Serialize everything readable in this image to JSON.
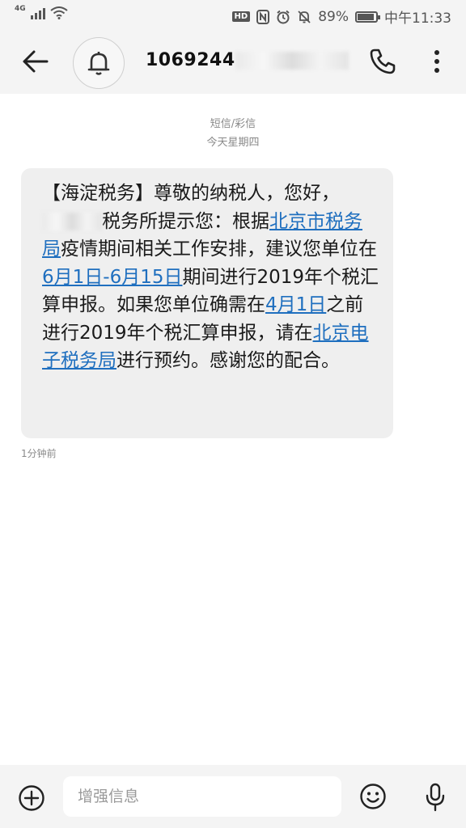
{
  "status_bar": {
    "network": "4G",
    "battery": "89%",
    "battery_level": 0.89,
    "time": "中午11:33",
    "icons": [
      "signal-icon",
      "wifi-icon",
      "hd-icon",
      "nfc-icon",
      "alarm-icon",
      "mute-icon",
      "battery-icon"
    ]
  },
  "header": {
    "contact": "1069244",
    "icons": [
      "back-arrow-icon",
      "bell-icon",
      "phone-icon",
      "more-vertical-icon"
    ]
  },
  "thread": {
    "message_type": "短信/彩信",
    "date_label": "今天星期四",
    "message": {
      "part1": "【海淀税务】尊敬的纳税人，您好，",
      "part2": "税务所提示您：根据",
      "link1": "北京市税务局",
      "part3": "疫情期间相关工作安排，建议您单位在",
      "link2": "6月1日-6月15日",
      "part4": "期间进行2019年个税汇算申报。如果您单位确需在",
      "link3": "4月1日",
      "part5": "之前进行2019年个税汇算申报，请在",
      "link4": "北京电子税务局",
      "part6": "进行预约。感谢您的配合。"
    },
    "timestamp": "1分钟前"
  },
  "composer": {
    "placeholder": "增强信息",
    "icons": [
      "add-icon",
      "emoji-icon",
      "microphone-icon"
    ]
  },
  "colors": {
    "link": "#1f6fbf",
    "bubble": "#efefef",
    "bar_background": "#f4f4f4"
  }
}
